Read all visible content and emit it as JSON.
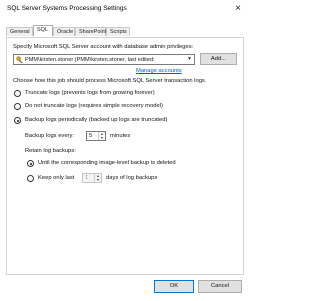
{
  "window": {
    "title": "SQL Server Systems Processing Settings",
    "close_glyph": "×"
  },
  "tabs": [
    {
      "label": "General",
      "active": false
    },
    {
      "label": "SQL",
      "active": true
    },
    {
      "label": "Oracle",
      "active": false
    },
    {
      "label": "SharePoint",
      "active": false
    },
    {
      "label": "Scripts",
      "active": false
    }
  ],
  "sql": {
    "account_prompt": "Specify Microsoft SQL Server account with database admin privileges:",
    "account_value": "PMM\\kirsten.stoner (PMM\\kirsten.stoner, last edited:",
    "add_label": "Add...",
    "manage_accounts_label": "Manage accounts",
    "log_prompt": "Choose how this job should process Microsoft SQL Server transaction logs.",
    "log_options": [
      {
        "label": "Truncate logs (prevents logs from growing forever)",
        "checked": false
      },
      {
        "label": "Do not truncate logs (requires simple recovery model)",
        "checked": false
      },
      {
        "label": "Backup logs periodically (backed up logs are truncated)",
        "checked": true
      }
    ],
    "backup_every_label": "Backup logs every:",
    "backup_every_value": "5",
    "backup_every_unit": "minutes",
    "retain_label": "Retain log backups:",
    "retain_options": [
      {
        "label": "Until the corresponding image-level backup is deleted",
        "checked": true
      },
      {
        "label": "Keep only last",
        "checked": false
      }
    ],
    "keep_last_value": "1",
    "keep_last_unit": "days of log backups"
  },
  "footer": {
    "ok_label": "OK",
    "cancel_label": "Cancel"
  },
  "colors": {
    "accent": "#0078d7",
    "link": "#0a58c2"
  }
}
